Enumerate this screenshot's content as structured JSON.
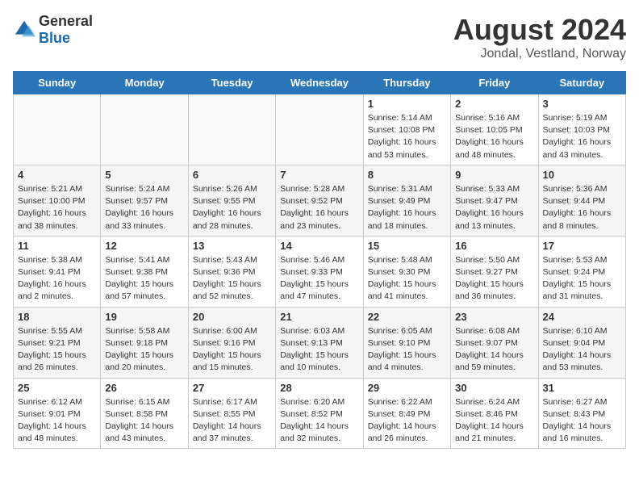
{
  "header": {
    "logo_general": "General",
    "logo_blue": "Blue",
    "title": "August 2024",
    "location": "Jondal, Vestland, Norway"
  },
  "weekdays": [
    "Sunday",
    "Monday",
    "Tuesday",
    "Wednesday",
    "Thursday",
    "Friday",
    "Saturday"
  ],
  "weeks": [
    [
      {
        "day": "",
        "info": ""
      },
      {
        "day": "",
        "info": ""
      },
      {
        "day": "",
        "info": ""
      },
      {
        "day": "",
        "info": ""
      },
      {
        "day": "1",
        "info": "Sunrise: 5:14 AM\nSunset: 10:08 PM\nDaylight: 16 hours\nand 53 minutes."
      },
      {
        "day": "2",
        "info": "Sunrise: 5:16 AM\nSunset: 10:05 PM\nDaylight: 16 hours\nand 48 minutes."
      },
      {
        "day": "3",
        "info": "Sunrise: 5:19 AM\nSunset: 10:03 PM\nDaylight: 16 hours\nand 43 minutes."
      }
    ],
    [
      {
        "day": "4",
        "info": "Sunrise: 5:21 AM\nSunset: 10:00 PM\nDaylight: 16 hours\nand 38 minutes."
      },
      {
        "day": "5",
        "info": "Sunrise: 5:24 AM\nSunset: 9:57 PM\nDaylight: 16 hours\nand 33 minutes."
      },
      {
        "day": "6",
        "info": "Sunrise: 5:26 AM\nSunset: 9:55 PM\nDaylight: 16 hours\nand 28 minutes."
      },
      {
        "day": "7",
        "info": "Sunrise: 5:28 AM\nSunset: 9:52 PM\nDaylight: 16 hours\nand 23 minutes."
      },
      {
        "day": "8",
        "info": "Sunrise: 5:31 AM\nSunset: 9:49 PM\nDaylight: 16 hours\nand 18 minutes."
      },
      {
        "day": "9",
        "info": "Sunrise: 5:33 AM\nSunset: 9:47 PM\nDaylight: 16 hours\nand 13 minutes."
      },
      {
        "day": "10",
        "info": "Sunrise: 5:36 AM\nSunset: 9:44 PM\nDaylight: 16 hours\nand 8 minutes."
      }
    ],
    [
      {
        "day": "11",
        "info": "Sunrise: 5:38 AM\nSunset: 9:41 PM\nDaylight: 16 hours\nand 2 minutes."
      },
      {
        "day": "12",
        "info": "Sunrise: 5:41 AM\nSunset: 9:38 PM\nDaylight: 15 hours\nand 57 minutes."
      },
      {
        "day": "13",
        "info": "Sunrise: 5:43 AM\nSunset: 9:36 PM\nDaylight: 15 hours\nand 52 minutes."
      },
      {
        "day": "14",
        "info": "Sunrise: 5:46 AM\nSunset: 9:33 PM\nDaylight: 15 hours\nand 47 minutes."
      },
      {
        "day": "15",
        "info": "Sunrise: 5:48 AM\nSunset: 9:30 PM\nDaylight: 15 hours\nand 41 minutes."
      },
      {
        "day": "16",
        "info": "Sunrise: 5:50 AM\nSunset: 9:27 PM\nDaylight: 15 hours\nand 36 minutes."
      },
      {
        "day": "17",
        "info": "Sunrise: 5:53 AM\nSunset: 9:24 PM\nDaylight: 15 hours\nand 31 minutes."
      }
    ],
    [
      {
        "day": "18",
        "info": "Sunrise: 5:55 AM\nSunset: 9:21 PM\nDaylight: 15 hours\nand 26 minutes."
      },
      {
        "day": "19",
        "info": "Sunrise: 5:58 AM\nSunset: 9:18 PM\nDaylight: 15 hours\nand 20 minutes."
      },
      {
        "day": "20",
        "info": "Sunrise: 6:00 AM\nSunset: 9:16 PM\nDaylight: 15 hours\nand 15 minutes."
      },
      {
        "day": "21",
        "info": "Sunrise: 6:03 AM\nSunset: 9:13 PM\nDaylight: 15 hours\nand 10 minutes."
      },
      {
        "day": "22",
        "info": "Sunrise: 6:05 AM\nSunset: 9:10 PM\nDaylight: 15 hours\nand 4 minutes."
      },
      {
        "day": "23",
        "info": "Sunrise: 6:08 AM\nSunset: 9:07 PM\nDaylight: 14 hours\nand 59 minutes."
      },
      {
        "day": "24",
        "info": "Sunrise: 6:10 AM\nSunset: 9:04 PM\nDaylight: 14 hours\nand 53 minutes."
      }
    ],
    [
      {
        "day": "25",
        "info": "Sunrise: 6:12 AM\nSunset: 9:01 PM\nDaylight: 14 hours\nand 48 minutes."
      },
      {
        "day": "26",
        "info": "Sunrise: 6:15 AM\nSunset: 8:58 PM\nDaylight: 14 hours\nand 43 minutes."
      },
      {
        "day": "27",
        "info": "Sunrise: 6:17 AM\nSunset: 8:55 PM\nDaylight: 14 hours\nand 37 minutes."
      },
      {
        "day": "28",
        "info": "Sunrise: 6:20 AM\nSunset: 8:52 PM\nDaylight: 14 hours\nand 32 minutes."
      },
      {
        "day": "29",
        "info": "Sunrise: 6:22 AM\nSunset: 8:49 PM\nDaylight: 14 hours\nand 26 minutes."
      },
      {
        "day": "30",
        "info": "Sunrise: 6:24 AM\nSunset: 8:46 PM\nDaylight: 14 hours\nand 21 minutes."
      },
      {
        "day": "31",
        "info": "Sunrise: 6:27 AM\nSunset: 8:43 PM\nDaylight: 14 hours\nand 16 minutes."
      }
    ]
  ]
}
